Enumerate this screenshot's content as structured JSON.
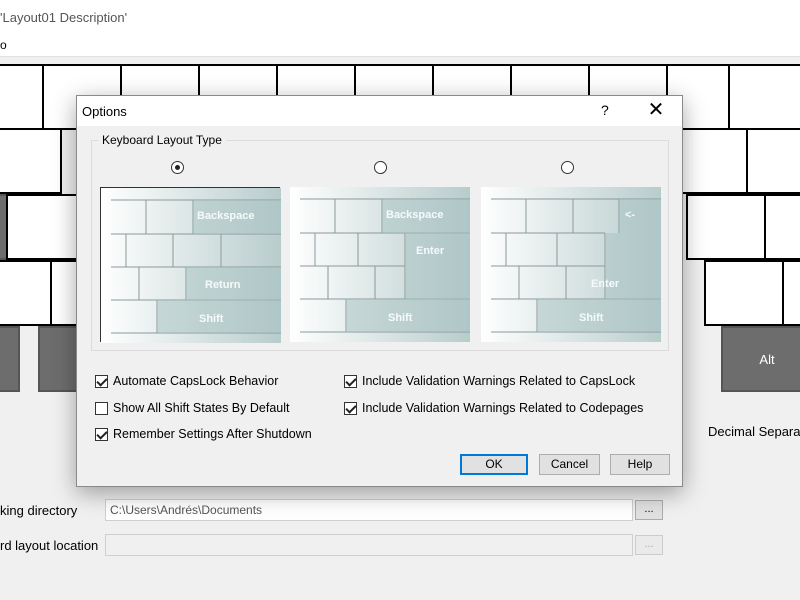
{
  "app": {
    "title": "'Layout01 Description'",
    "menu_fragment": "o",
    "decimal_separator_label": "Decimal Separato",
    "working_directory_label": "king directory",
    "working_directory_value": "C:\\Users\\Andrés\\Documents",
    "keyboard_layout_location_label": "rd layout location",
    "keyboard_layout_location_value": "",
    "browse_label": "...",
    "alt_key_label": "Alt"
  },
  "dialog": {
    "title": "Options",
    "help_glyph": "?",
    "close_glyph": "✕",
    "group_label": "Keyboard Layout Type",
    "layout_options": [
      {
        "selected": true,
        "labels": [
          "Backspace",
          "Return",
          "Shift"
        ]
      },
      {
        "selected": false,
        "labels": [
          "Backspace",
          "Enter",
          "Shift"
        ]
      },
      {
        "selected": false,
        "labels": [
          "<-",
          "Enter",
          "Shift"
        ]
      }
    ],
    "checkboxes": [
      {
        "label": "Automate CapsLock Behavior",
        "checked": true
      },
      {
        "label": "Show All Shift States By Default",
        "checked": false
      },
      {
        "label": "Remember Settings After Shutdown",
        "checked": true
      },
      {
        "label": "Include Validation Warnings Related to CapsLock",
        "checked": true
      },
      {
        "label": "Include Validation Warnings Related to Codepages",
        "checked": true
      }
    ],
    "buttons": {
      "ok": "OK",
      "cancel": "Cancel",
      "help": "Help"
    }
  }
}
